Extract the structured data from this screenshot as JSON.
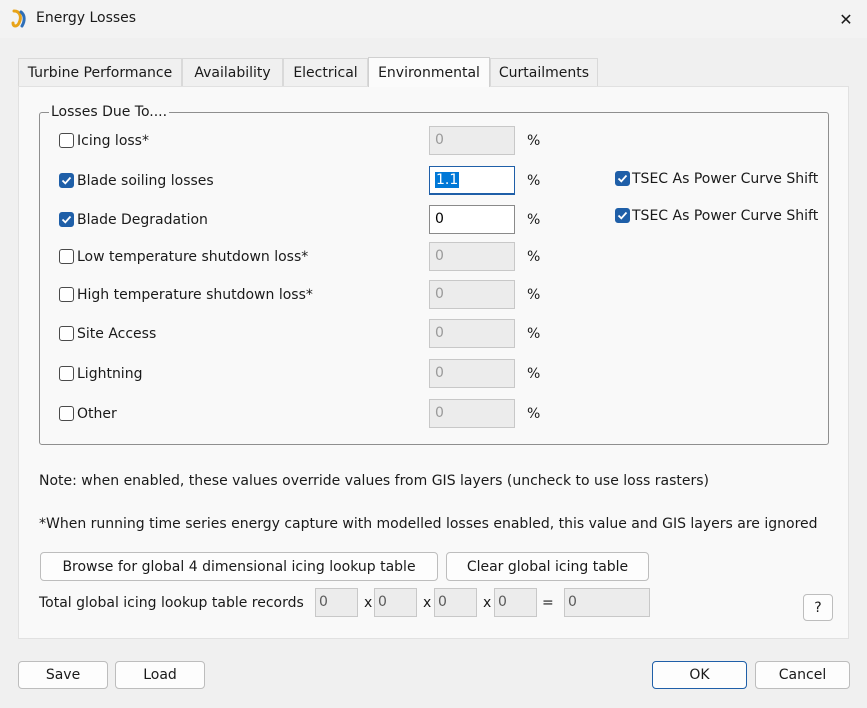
{
  "window": {
    "title": "Energy Losses",
    "close_glyph": "✕",
    "app_icon": "app-logo-icon"
  },
  "tabs": [
    {
      "label": "Turbine Performance",
      "active": false
    },
    {
      "label": "Availability",
      "active": false
    },
    {
      "label": "Electrical",
      "active": false
    },
    {
      "label": "Environmental",
      "active": true
    },
    {
      "label": "Curtailments",
      "active": false
    }
  ],
  "losses_group": {
    "legend": "Losses Due To....",
    "unit": "%",
    "rows": [
      {
        "label": "Icing loss*",
        "checked": false,
        "value": "0"
      },
      {
        "label": "Blade soiling losses",
        "checked": true,
        "value": "1.1"
      },
      {
        "label": "Blade Degradation",
        "checked": true,
        "value": "0"
      },
      {
        "label": "Low temperature shutdown loss*",
        "checked": false,
        "value": "0"
      },
      {
        "label": "High temperature shutdown loss*",
        "checked": false,
        "value": "0"
      },
      {
        "label": "Site Access",
        "checked": false,
        "value": "0"
      },
      {
        "label": "Lightning",
        "checked": false,
        "value": "0"
      },
      {
        "label": "Other",
        "checked": false,
        "value": "0"
      }
    ],
    "tsec_options": [
      {
        "label": "TSEC As Power Curve Shift",
        "checked": true
      },
      {
        "label": "TSEC As Power Curve Shift",
        "checked": true
      }
    ]
  },
  "notes": {
    "gis": "Note: when enabled, these values override values from GIS layers (uncheck to use loss rasters)",
    "time_series": "*When running time series energy capture with modelled losses enabled, this value and GIS layers are ignored"
  },
  "icing_table": {
    "browse_label": "Browse for global 4 dimensional icing lookup table",
    "clear_label": "Clear global icing table",
    "records_label": "Total global icing lookup table records",
    "dims": [
      "0",
      "0",
      "0",
      "0"
    ],
    "times_symbol": "x",
    "equals_symbol": "=",
    "total": "0",
    "help_label": "?"
  },
  "footer": {
    "save_label": "Save",
    "load_label": "Load",
    "ok_label": "OK",
    "cancel_label": "Cancel"
  },
  "colors": {
    "accent": "#1f5fa8",
    "selection": "#0078d7"
  }
}
